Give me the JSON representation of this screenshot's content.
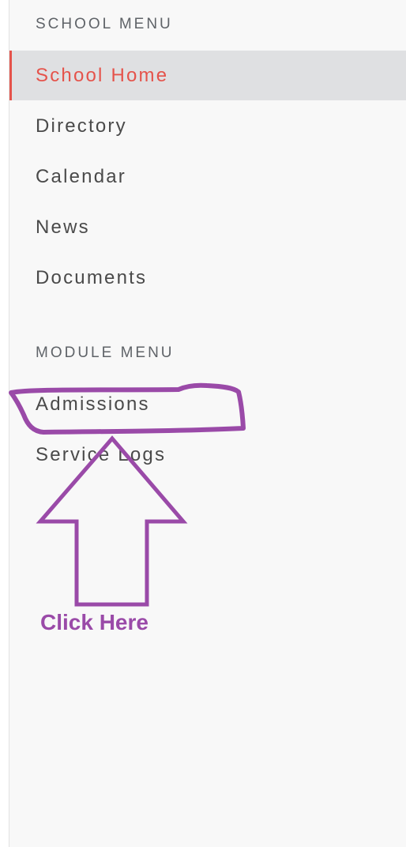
{
  "sidebar": {
    "school_menu": {
      "header": "SCHOOL MENU",
      "items": [
        {
          "label": "School Home",
          "active": true
        },
        {
          "label": "Directory",
          "active": false
        },
        {
          "label": "Calendar",
          "active": false
        },
        {
          "label": "News",
          "active": false
        },
        {
          "label": "Documents",
          "active": false
        }
      ]
    },
    "module_menu": {
      "header": "MODULE MENU",
      "items": [
        {
          "label": "Admissions",
          "active": false
        },
        {
          "label": "Service Logs",
          "active": false
        }
      ]
    }
  },
  "annotation": {
    "text": "Click Here",
    "color": "#9a4aa8",
    "shape": "arrow-up-and-circle"
  },
  "colors": {
    "accent": "#e5534b",
    "active_bg": "#dfe0e2",
    "text": "#4a4a4a",
    "sidebar_bg": "#f8f8f8"
  }
}
